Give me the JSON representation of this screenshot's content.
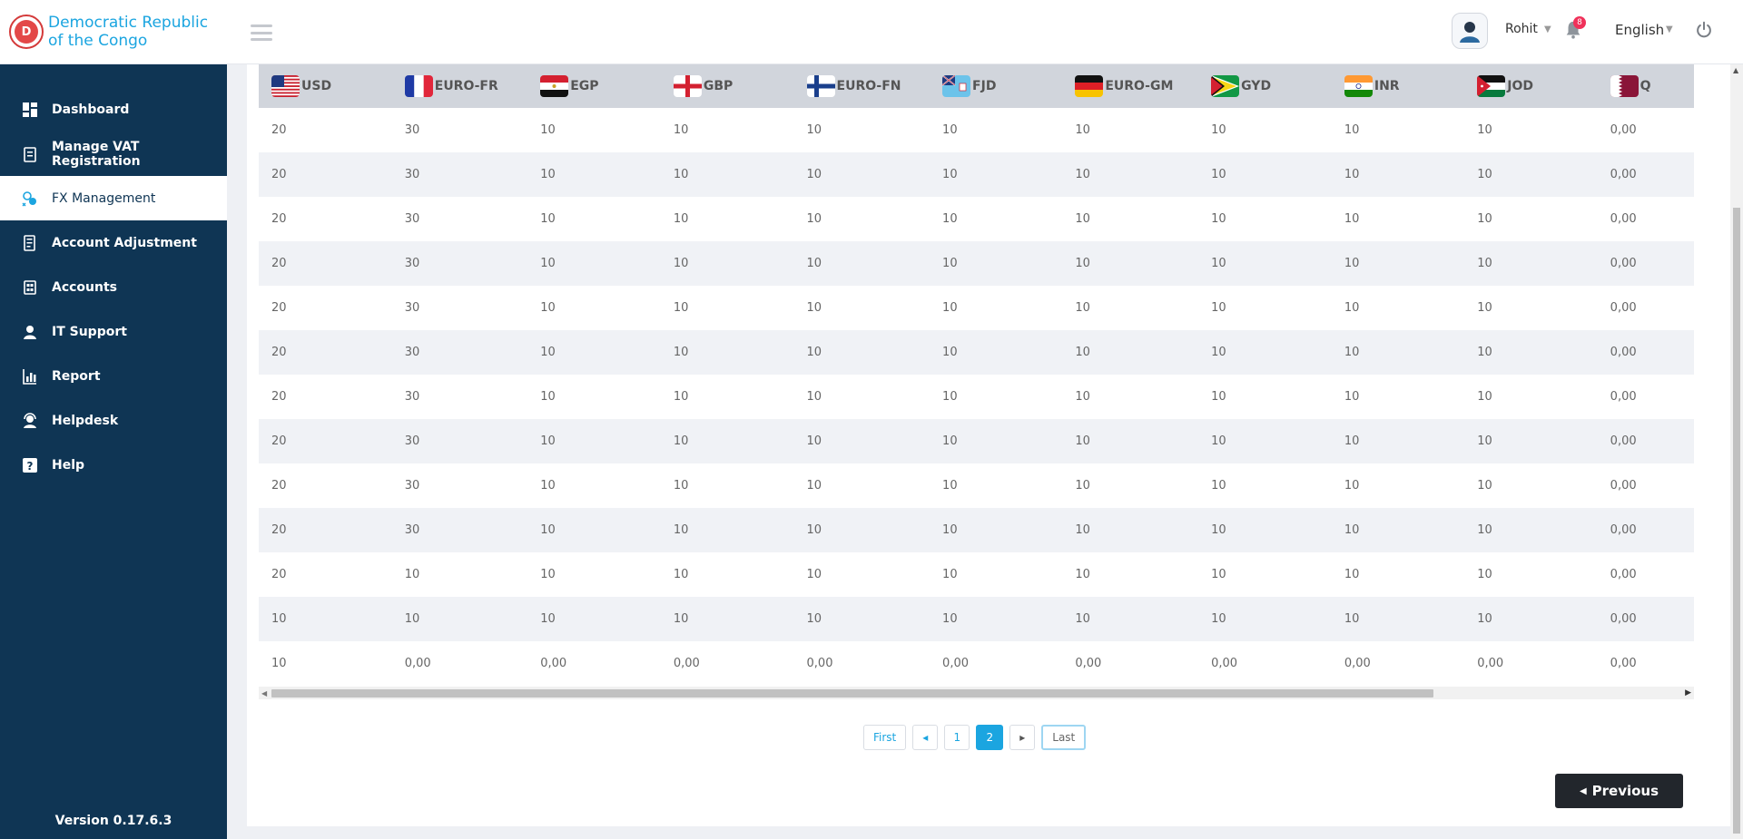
{
  "brand": {
    "name": "Democratic Republic of the Congo",
    "logo_letter": "D"
  },
  "sidebar": {
    "items": [
      {
        "label": "Dashboard",
        "icon": "dashboard-icon",
        "active": false
      },
      {
        "label": "Manage VAT Registration",
        "icon": "vat-registration-icon",
        "active": false
      },
      {
        "label": "FX Management",
        "icon": "fx-management-icon",
        "active": true
      },
      {
        "label": "Account Adjustment",
        "icon": "account-adjustment-icon",
        "active": false
      },
      {
        "label": "Accounts",
        "icon": "accounts-icon",
        "active": false
      },
      {
        "label": "IT Support",
        "icon": "it-support-icon",
        "active": false
      },
      {
        "label": "Report",
        "icon": "report-icon",
        "active": false
      },
      {
        "label": "Helpdesk",
        "icon": "helpdesk-icon",
        "active": false
      },
      {
        "label": "Help",
        "icon": "help-icon",
        "active": false
      }
    ],
    "version": "Version 0.17.6.3"
  },
  "header": {
    "user_name": "Rohit",
    "notification_count": "8",
    "language": "English"
  },
  "table": {
    "columns": [
      "USD",
      "EURO-FR",
      "EGP",
      "GBP",
      "EURO-FN",
      "FJD",
      "EURO-GM",
      "GYD",
      "INR",
      "JOD",
      "Q"
    ],
    "rows": [
      [
        "20",
        "30",
        "10",
        "10",
        "10",
        "10",
        "10",
        "10",
        "10",
        "10",
        "0,00"
      ],
      [
        "20",
        "30",
        "10",
        "10",
        "10",
        "10",
        "10",
        "10",
        "10",
        "10",
        "0,00"
      ],
      [
        "20",
        "30",
        "10",
        "10",
        "10",
        "10",
        "10",
        "10",
        "10",
        "10",
        "0,00"
      ],
      [
        "20",
        "30",
        "10",
        "10",
        "10",
        "10",
        "10",
        "10",
        "10",
        "10",
        "0,00"
      ],
      [
        "20",
        "30",
        "10",
        "10",
        "10",
        "10",
        "10",
        "10",
        "10",
        "10",
        "0,00"
      ],
      [
        "20",
        "30",
        "10",
        "10",
        "10",
        "10",
        "10",
        "10",
        "10",
        "10",
        "0,00"
      ],
      [
        "20",
        "30",
        "10",
        "10",
        "10",
        "10",
        "10",
        "10",
        "10",
        "10",
        "0,00"
      ],
      [
        "20",
        "30",
        "10",
        "10",
        "10",
        "10",
        "10",
        "10",
        "10",
        "10",
        "0,00"
      ],
      [
        "20",
        "30",
        "10",
        "10",
        "10",
        "10",
        "10",
        "10",
        "10",
        "10",
        "0,00"
      ],
      [
        "20",
        "30",
        "10",
        "10",
        "10",
        "10",
        "10",
        "10",
        "10",
        "10",
        "0,00"
      ],
      [
        "20",
        "10",
        "10",
        "10",
        "10",
        "10",
        "10",
        "10",
        "10",
        "10",
        "0,00"
      ],
      [
        "10",
        "10",
        "10",
        "10",
        "10",
        "10",
        "10",
        "10",
        "10",
        "10",
        "0,00"
      ],
      [
        "10",
        "0,00",
        "0,00",
        "0,00",
        "0,00",
        "0,00",
        "0,00",
        "0,00",
        "0,00",
        "0,00",
        "0,00"
      ]
    ]
  },
  "pagination": {
    "first": "First",
    "page1": "1",
    "page2": "2",
    "last": "Last"
  },
  "previous_button": "Previous",
  "colors": {
    "sidebar_bg": "#0f3554",
    "accent": "#1ba5e0",
    "badge": "#f0315a",
    "header_row": "#d1d5dc"
  }
}
